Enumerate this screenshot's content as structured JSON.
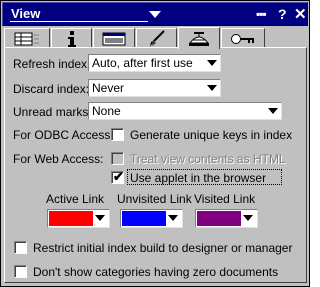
{
  "title": "View",
  "title_icons": [
    "grip-icon",
    "help-icon",
    "close-icon"
  ],
  "tabs": [
    {
      "name": "tab-basics",
      "icon": "table-icon",
      "active": false
    },
    {
      "name": "tab-info",
      "icon": "info-icon",
      "active": false
    },
    {
      "name": "tab-window",
      "icon": "window-icon",
      "active": false
    },
    {
      "name": "tab-style",
      "icon": "brush-icon",
      "active": false
    },
    {
      "name": "tab-advanced",
      "icon": "beanie-icon",
      "active": true
    },
    {
      "name": "tab-security",
      "icon": "key-icon",
      "active": false
    }
  ],
  "refresh_index": {
    "label": "Refresh index:",
    "value": "Auto, after first use"
  },
  "discard_index": {
    "label": "Discard index:",
    "value": "Never"
  },
  "unread_marks": {
    "label": "Unread marks:",
    "value": "None"
  },
  "odbc": {
    "label": "For ODBC Access:",
    "option": "Generate unique keys in index",
    "checked": false
  },
  "web": {
    "label": "For Web Access:",
    "treat_html": {
      "text": "Treat view contents as HTML",
      "checked": false,
      "disabled": true
    },
    "use_applet": {
      "text": "Use applet in the browser",
      "checked": true
    }
  },
  "links": {
    "active": {
      "label": "Active Link",
      "color": "#ff0000"
    },
    "unvisited": {
      "label": "Unvisited Link",
      "color": "#0000ff"
    },
    "visited": {
      "label": "Visited Link",
      "color": "#800080"
    }
  },
  "restrict": {
    "text": "Restrict initial index build to designer or manager",
    "checked": false
  },
  "zero_docs": {
    "text": "Don't show categories having zero documents",
    "checked": false
  },
  "check_mark": "✔"
}
